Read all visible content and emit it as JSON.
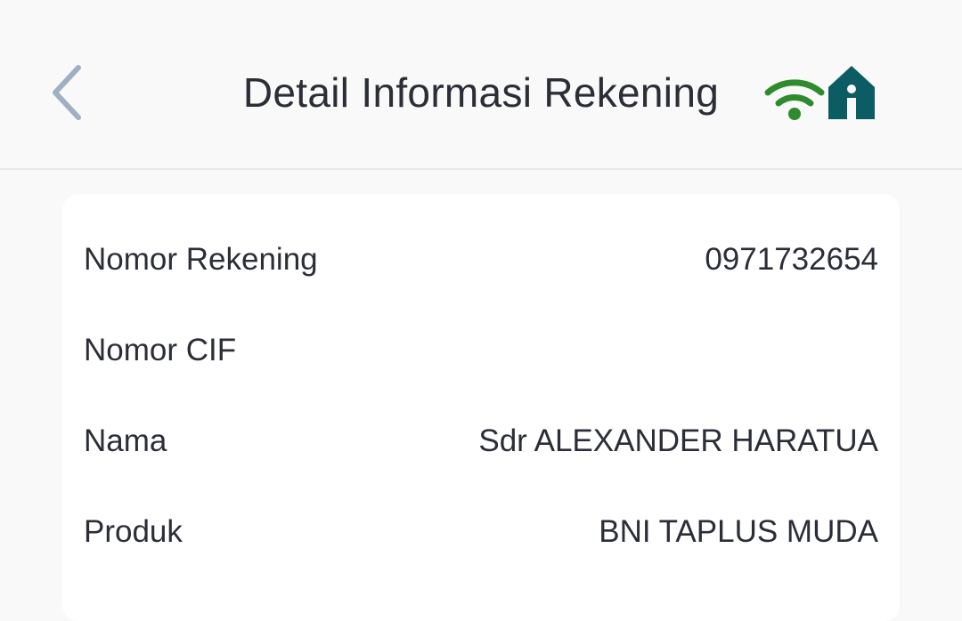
{
  "header": {
    "title": "Detail Informasi Rekening",
    "back_icon": "chevron-left-icon",
    "status_icons": [
      {
        "name": "wifi-icon",
        "color": "#2e8b2e"
      },
      {
        "name": "home-icon",
        "color": "#0b5d63"
      }
    ]
  },
  "details": {
    "rows": [
      {
        "label": "Nomor Rekening",
        "value": "0971732654"
      },
      {
        "label": "Nomor CIF",
        "value": ""
      },
      {
        "label": "Nama",
        "value": "Sdr ALEXANDER HARATUA"
      },
      {
        "label": "Produk",
        "value": "BNI TAPLUS MUDA"
      }
    ]
  },
  "colors": {
    "background": "#f9f9f9",
    "card": "#ffffff",
    "text": "#2c2e37",
    "back_icon": "#9fb0c4"
  }
}
